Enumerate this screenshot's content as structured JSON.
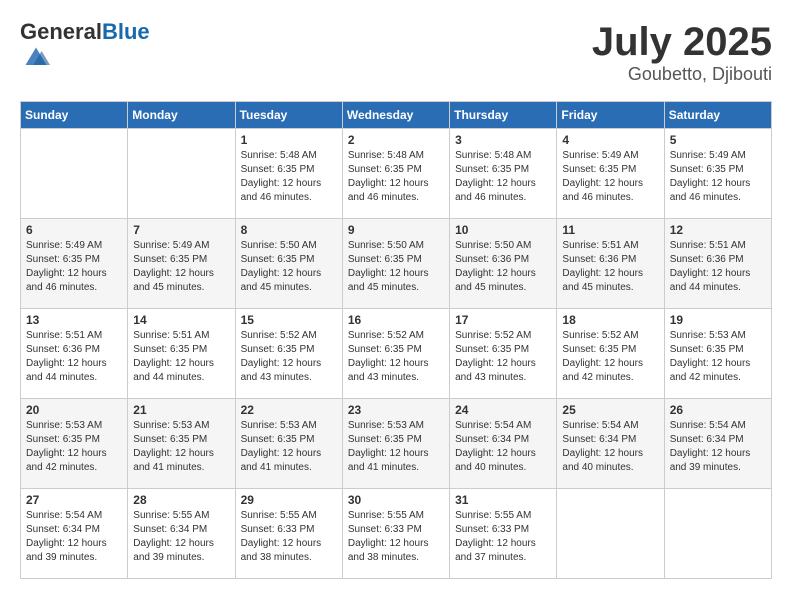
{
  "header": {
    "logo_general": "General",
    "logo_blue": "Blue",
    "month": "July 2025",
    "location": "Goubetto, Djibouti"
  },
  "weekdays": [
    "Sunday",
    "Monday",
    "Tuesday",
    "Wednesday",
    "Thursday",
    "Friday",
    "Saturday"
  ],
  "weeks": [
    [
      {
        "day": "",
        "sunrise": "",
        "sunset": "",
        "daylight": ""
      },
      {
        "day": "",
        "sunrise": "",
        "sunset": "",
        "daylight": ""
      },
      {
        "day": "1",
        "sunrise": "Sunrise: 5:48 AM",
        "sunset": "Sunset: 6:35 PM",
        "daylight": "Daylight: 12 hours and 46 minutes."
      },
      {
        "day": "2",
        "sunrise": "Sunrise: 5:48 AM",
        "sunset": "Sunset: 6:35 PM",
        "daylight": "Daylight: 12 hours and 46 minutes."
      },
      {
        "day": "3",
        "sunrise": "Sunrise: 5:48 AM",
        "sunset": "Sunset: 6:35 PM",
        "daylight": "Daylight: 12 hours and 46 minutes."
      },
      {
        "day": "4",
        "sunrise": "Sunrise: 5:49 AM",
        "sunset": "Sunset: 6:35 PM",
        "daylight": "Daylight: 12 hours and 46 minutes."
      },
      {
        "day": "5",
        "sunrise": "Sunrise: 5:49 AM",
        "sunset": "Sunset: 6:35 PM",
        "daylight": "Daylight: 12 hours and 46 minutes."
      }
    ],
    [
      {
        "day": "6",
        "sunrise": "Sunrise: 5:49 AM",
        "sunset": "Sunset: 6:35 PM",
        "daylight": "Daylight: 12 hours and 46 minutes."
      },
      {
        "day": "7",
        "sunrise": "Sunrise: 5:49 AM",
        "sunset": "Sunset: 6:35 PM",
        "daylight": "Daylight: 12 hours and 45 minutes."
      },
      {
        "day": "8",
        "sunrise": "Sunrise: 5:50 AM",
        "sunset": "Sunset: 6:35 PM",
        "daylight": "Daylight: 12 hours and 45 minutes."
      },
      {
        "day": "9",
        "sunrise": "Sunrise: 5:50 AM",
        "sunset": "Sunset: 6:35 PM",
        "daylight": "Daylight: 12 hours and 45 minutes."
      },
      {
        "day": "10",
        "sunrise": "Sunrise: 5:50 AM",
        "sunset": "Sunset: 6:36 PM",
        "daylight": "Daylight: 12 hours and 45 minutes."
      },
      {
        "day": "11",
        "sunrise": "Sunrise: 5:51 AM",
        "sunset": "Sunset: 6:36 PM",
        "daylight": "Daylight: 12 hours and 45 minutes."
      },
      {
        "day": "12",
        "sunrise": "Sunrise: 5:51 AM",
        "sunset": "Sunset: 6:36 PM",
        "daylight": "Daylight: 12 hours and 44 minutes."
      }
    ],
    [
      {
        "day": "13",
        "sunrise": "Sunrise: 5:51 AM",
        "sunset": "Sunset: 6:36 PM",
        "daylight": "Daylight: 12 hours and 44 minutes."
      },
      {
        "day": "14",
        "sunrise": "Sunrise: 5:51 AM",
        "sunset": "Sunset: 6:35 PM",
        "daylight": "Daylight: 12 hours and 44 minutes."
      },
      {
        "day": "15",
        "sunrise": "Sunrise: 5:52 AM",
        "sunset": "Sunset: 6:35 PM",
        "daylight": "Daylight: 12 hours and 43 minutes."
      },
      {
        "day": "16",
        "sunrise": "Sunrise: 5:52 AM",
        "sunset": "Sunset: 6:35 PM",
        "daylight": "Daylight: 12 hours and 43 minutes."
      },
      {
        "day": "17",
        "sunrise": "Sunrise: 5:52 AM",
        "sunset": "Sunset: 6:35 PM",
        "daylight": "Daylight: 12 hours and 43 minutes."
      },
      {
        "day": "18",
        "sunrise": "Sunrise: 5:52 AM",
        "sunset": "Sunset: 6:35 PM",
        "daylight": "Daylight: 12 hours and 42 minutes."
      },
      {
        "day": "19",
        "sunrise": "Sunrise: 5:53 AM",
        "sunset": "Sunset: 6:35 PM",
        "daylight": "Daylight: 12 hours and 42 minutes."
      }
    ],
    [
      {
        "day": "20",
        "sunrise": "Sunrise: 5:53 AM",
        "sunset": "Sunset: 6:35 PM",
        "daylight": "Daylight: 12 hours and 42 minutes."
      },
      {
        "day": "21",
        "sunrise": "Sunrise: 5:53 AM",
        "sunset": "Sunset: 6:35 PM",
        "daylight": "Daylight: 12 hours and 41 minutes."
      },
      {
        "day": "22",
        "sunrise": "Sunrise: 5:53 AM",
        "sunset": "Sunset: 6:35 PM",
        "daylight": "Daylight: 12 hours and 41 minutes."
      },
      {
        "day": "23",
        "sunrise": "Sunrise: 5:53 AM",
        "sunset": "Sunset: 6:35 PM",
        "daylight": "Daylight: 12 hours and 41 minutes."
      },
      {
        "day": "24",
        "sunrise": "Sunrise: 5:54 AM",
        "sunset": "Sunset: 6:34 PM",
        "daylight": "Daylight: 12 hours and 40 minutes."
      },
      {
        "day": "25",
        "sunrise": "Sunrise: 5:54 AM",
        "sunset": "Sunset: 6:34 PM",
        "daylight": "Daylight: 12 hours and 40 minutes."
      },
      {
        "day": "26",
        "sunrise": "Sunrise: 5:54 AM",
        "sunset": "Sunset: 6:34 PM",
        "daylight": "Daylight: 12 hours and 39 minutes."
      }
    ],
    [
      {
        "day": "27",
        "sunrise": "Sunrise: 5:54 AM",
        "sunset": "Sunset: 6:34 PM",
        "daylight": "Daylight: 12 hours and 39 minutes."
      },
      {
        "day": "28",
        "sunrise": "Sunrise: 5:55 AM",
        "sunset": "Sunset: 6:34 PM",
        "daylight": "Daylight: 12 hours and 39 minutes."
      },
      {
        "day": "29",
        "sunrise": "Sunrise: 5:55 AM",
        "sunset": "Sunset: 6:33 PM",
        "daylight": "Daylight: 12 hours and 38 minutes."
      },
      {
        "day": "30",
        "sunrise": "Sunrise: 5:55 AM",
        "sunset": "Sunset: 6:33 PM",
        "daylight": "Daylight: 12 hours and 38 minutes."
      },
      {
        "day": "31",
        "sunrise": "Sunrise: 5:55 AM",
        "sunset": "Sunset: 6:33 PM",
        "daylight": "Daylight: 12 hours and 37 minutes."
      },
      {
        "day": "",
        "sunrise": "",
        "sunset": "",
        "daylight": ""
      },
      {
        "day": "",
        "sunrise": "",
        "sunset": "",
        "daylight": ""
      }
    ]
  ]
}
